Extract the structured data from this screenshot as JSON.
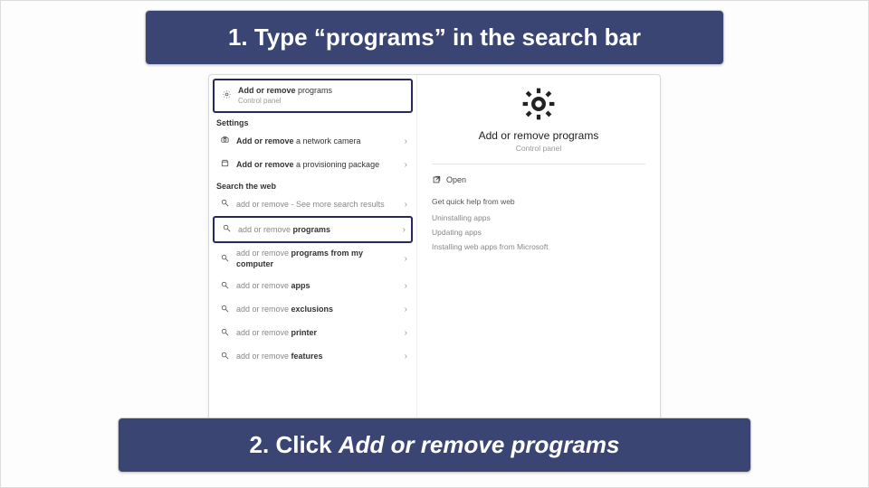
{
  "banner_top_prefix": "1.   Type “",
  "banner_top_term": "programs",
  "banner_top_suffix": "” in the search bar",
  "banner_bottom_prefix": "2. Click ",
  "banner_bottom_em": "Add or remove programs",
  "left": {
    "top_result": {
      "bold": "Add or remove",
      "rest": " programs",
      "subtitle": "Control panel"
    },
    "section1": "Settings",
    "settings": [
      {
        "bold": "Add or remove",
        "rest": " a network camera"
      },
      {
        "bold": "Add or remove",
        "rest": " a provisioning package"
      }
    ],
    "section2": "Search the web",
    "web": [
      {
        "gray": "add or remove",
        "bold": "",
        "rest": " - See more search results"
      },
      {
        "gray": "add or remove ",
        "bold": "programs",
        "rest": ""
      },
      {
        "gray": "add or remove ",
        "bold": "programs from my computer",
        "rest": ""
      },
      {
        "gray": "add or remove ",
        "bold": "apps",
        "rest": ""
      },
      {
        "gray": "add or remove ",
        "bold": "exclusions",
        "rest": ""
      },
      {
        "gray": "add or remove ",
        "bold": "printer",
        "rest": ""
      },
      {
        "gray": "add or remove ",
        "bold": "features",
        "rest": ""
      }
    ]
  },
  "right": {
    "title": "Add or remove programs",
    "subtitle": "Control panel",
    "open": "Open",
    "help_heading": "Get quick help from web",
    "help_links": [
      "Uninstalling apps",
      "Updating apps",
      "Installing web apps from Microsoft"
    ]
  }
}
